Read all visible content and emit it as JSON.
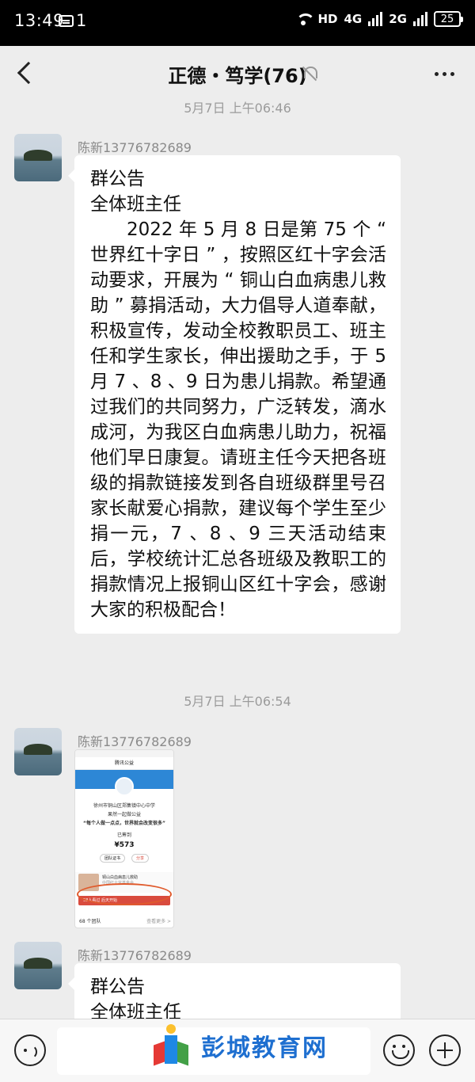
{
  "status_bar": {
    "time": "13:49",
    "notification_count": "1",
    "network_label_1": "HD",
    "network_label_2": "4G",
    "network_label_3": "2G",
    "battery": "25"
  },
  "nav": {
    "title": "正德・笃学(76)"
  },
  "chat": {
    "timestamp_top": "5月7日 上午06:46",
    "timestamp_second": "5月7日 上午06:54",
    "messages": [
      {
        "sender": "陈新13776782689",
        "lines": [
          "群公告",
          "全体班主任"
        ],
        "paragraph": "2022 年 5 月 8 日是第 75 个 “ 世界红十字日 ” ，按照区红十字会活动要求，开展为 “ 铜山白血病患儿救助 ” 募捐活动，大力倡导人道奉献，积极宣传，发动全校教职员工、班主任和学生家长，伸出援助之手，于 5 月 7 、8 、9 日为患儿捐款。希望通过我们的共同努力，广泛转发，滴水成河，为我区白血病患儿助力，祝福他们早日康复。请班主任今天把各班级的捐款链接发到各自班级群里号召家长献爱心捐款，建议每个学生至少捐一元，7 、8 、9 三天活动结束后，学校统计汇总各班级及教职工的捐款情况上报铜山区红十字会，感谢大家的积极配合！"
      },
      {
        "sender": "陈新13776782689",
        "image": {
          "header": "腾讯公益",
          "org": "徐州市铜山区郑集镇中心中学",
          "sub": "果然一起做公益",
          "slogan": "“每个人做一点点，世界就会改变很多”",
          "raised_label": "已筹到",
          "amount": "¥573",
          "btn_1": "团队证书",
          "btn_2": "分享",
          "item_title": "铜山白血病患儿救助",
          "item_sub": "中国红十字基金会",
          "red_bar": "58人看过 后天开始",
          "teams": "68 个团队",
          "more": "查看更多 >"
        }
      },
      {
        "sender": "陈新13776782689",
        "lines": [
          "群公告",
          "全体班主任"
        ]
      }
    ]
  },
  "input_bar": {
    "watermark": "彭城教育网"
  }
}
